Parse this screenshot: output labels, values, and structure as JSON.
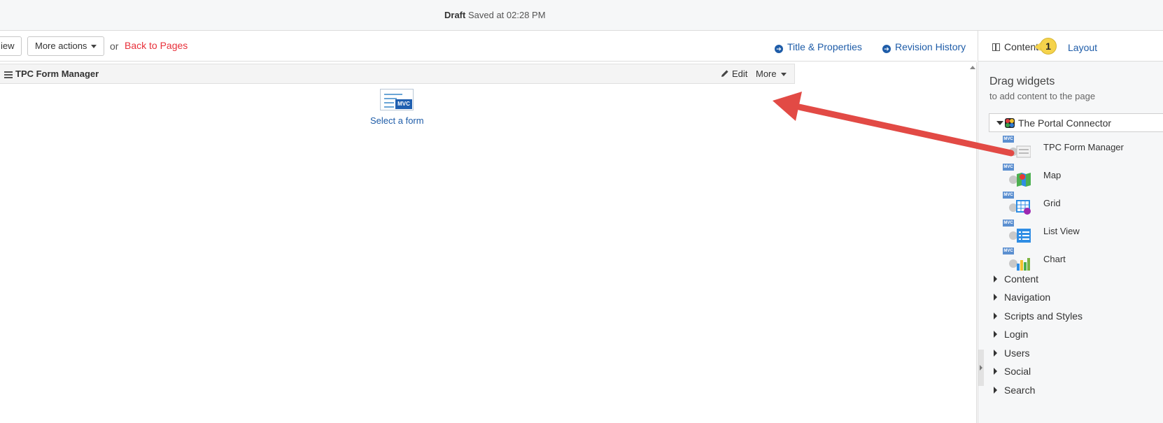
{
  "status": {
    "draft_label": "Draft",
    "saved_text": "Saved at 02:28 PM"
  },
  "toolbar": {
    "view_label": "iew",
    "more_actions_label": "More actions",
    "or_text": "or",
    "back_label": "Back to Pages",
    "title_properties_label": "Title & Properties",
    "revision_history_label": "Revision History"
  },
  "canvas": {
    "widget_title": "TPC Form Manager",
    "edit_label": "Edit",
    "more_label": "More",
    "thumb_tag": "MVC",
    "select_form_label": "Select a form"
  },
  "panel": {
    "tabs": {
      "content_label": "Content",
      "layout_label": "Layout"
    },
    "callout_number": "1",
    "drag_title": "Drag widgets",
    "drag_subtitle": "to add content to the page",
    "group": {
      "title": "The Portal Connector",
      "widgets": [
        {
          "label": "TPC Form Manager",
          "tag": "MVC",
          "icon": "form-manager-icon"
        },
        {
          "label": "Map",
          "tag": "MVC",
          "icon": "map-icon"
        },
        {
          "label": "Grid",
          "tag": "MVC",
          "icon": "grid-icon"
        },
        {
          "label": "List View",
          "tag": "MVC",
          "icon": "list-view-icon"
        },
        {
          "label": "Chart",
          "tag": "MVC",
          "icon": "chart-icon"
        }
      ]
    },
    "categories": [
      "Content",
      "Navigation",
      "Scripts and Styles",
      "Login",
      "Users",
      "Social",
      "Search"
    ]
  },
  "colors": {
    "link_blue": "#1e5ca8",
    "back_red": "#e8303a",
    "arrow_red": "#e24a45",
    "callout_yellow": "#f5d34c"
  }
}
